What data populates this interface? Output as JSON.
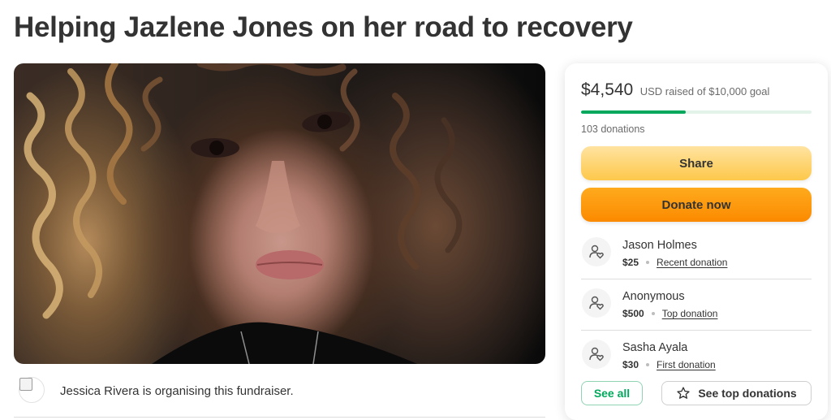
{
  "page": {
    "title": "Helping Jazlene Jones on her road to recovery"
  },
  "hero": {
    "image_icon": "portrait-photo"
  },
  "organiser": {
    "avatar_icon": "broken-image-icon",
    "text": "Jessica Rivera is organising this fundraiser."
  },
  "donation_card": {
    "amount_raised": "$4,540",
    "raised_suffix": "USD raised of $10,000 goal",
    "progress_fraction": 0.454,
    "donations_count": "103 donations",
    "share_label": "Share",
    "donate_label": "Donate now",
    "donors": [
      {
        "name": "Jason Holmes",
        "amount": "$25",
        "tag": "Recent donation",
        "icon": "donor-heart-icon"
      },
      {
        "name": "Anonymous",
        "amount": "$500",
        "tag": "Top donation",
        "icon": "donor-heart-icon"
      },
      {
        "name": "Sasha Ayala",
        "amount": "$30",
        "tag": "First donation",
        "icon": "donor-heart-icon"
      }
    ],
    "see_all_label": "See all",
    "see_top_label": "See top donations",
    "star_icon": "star-outline-icon"
  },
  "colors": {
    "accent_green": "#02a95c",
    "share_yellow": "#fdc84b",
    "donate_orange": "#fb8a00"
  }
}
